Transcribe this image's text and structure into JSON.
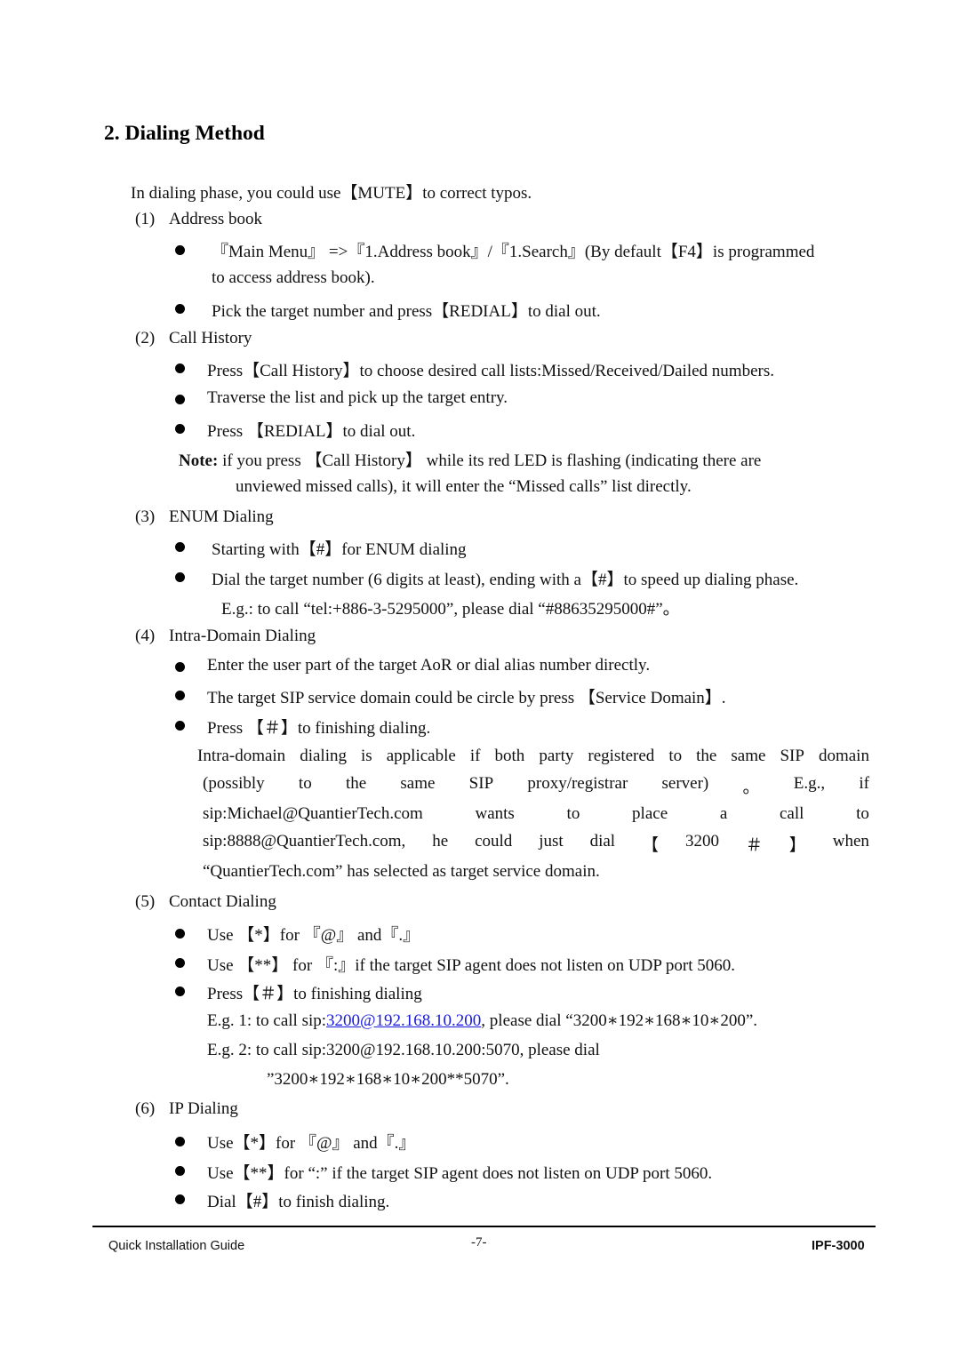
{
  "heading": "2.  Dialing Method",
  "intro": "In dialing phase, you could use【MUTE】to correct typos.",
  "sections": [
    {
      "num": "(1)",
      "title": "Address book",
      "bullets": [
        "『Main Menu』 =>『1.Address book』/『1.Search』(By default【F4】is programmed",
        "Pick the target number and press【REDIAL】to dial out."
      ],
      "continuation": "to access address book)."
    },
    {
      "num": "(2)",
      "title": "Call History",
      "bullets": [
        "Press【Call History】to choose desired call lists:Missed/Received/Dailed numbers.",
        "Traverse the list and pick up the target entry.",
        "Press 【REDIAL】to dial out."
      ],
      "note_label": "Note:",
      "note_line1": " if you press 【Call History】 while its red LED is flashing (indicating there are",
      "note_line2": "unviewed missed calls), it will enter the “Missed calls” list directly."
    },
    {
      "num": "(3)",
      "title": "ENUM Dialing",
      "bullets": [
        "Starting with【#】for ENUM dialing",
        "Dial the target number (6 digits at least), ending with a【#】to speed up dialing phase."
      ],
      "example": "E.g.: to call “tel:+886-3-5295000”, please dial “#88635295000#”。"
    },
    {
      "num": "(4)",
      "title": "Intra-Domain Dialing",
      "bullets": [
        "Enter the user part of the target AoR or dial alias number directly.",
        "The target SIP service domain could be circle by press 【Service Domain】.",
        "Press 【＃】to finishing dialing."
      ],
      "paragraph_lines": [
        [
          "Intra-domain",
          "dialing",
          "is",
          "applicable",
          "if",
          "both",
          "party",
          "registered",
          "to",
          "the",
          "same",
          "SIP",
          "domain"
        ],
        [
          "(possibly",
          "to",
          "the",
          "same",
          "SIP",
          "proxy/registrar",
          "server)",
          "。",
          "E.g.,",
          "if"
        ],
        [
          "sip:Michael@QuantierTech.com",
          "wants",
          "to",
          "place",
          "a",
          "call",
          "to"
        ],
        [
          "sip:8888@QuantierTech.com,",
          "he",
          "could",
          "just",
          "dial",
          "【",
          "3200",
          "＃",
          "】",
          "when"
        ]
      ],
      "paragraph_last": "“QuantierTech.com” has selected as target service domain."
    },
    {
      "num": "(5)",
      "title": "Contact Dialing",
      "bullets": [
        "Use 【*】for 『@』 and『.』",
        "Use 【**】 for 『:』if the target SIP agent does not listen on UDP port 5060.",
        "Press【＃】to finishing dialing"
      ],
      "eg1_prefix": "E.g. 1: to call sip:",
      "eg1_link": "3200@192.168.10.200",
      "eg1_suffix": ", please dial “3200∗192∗168∗10∗200”.",
      "eg2_line1": "E.g. 2: to call sip:3200@192.168.10.200:5070, please dial",
      "eg2_line2": "”3200∗192∗168∗10∗200**5070”."
    },
    {
      "num": "(6)",
      "title": "IP Dialing",
      "bullets": [
        "Use【*】for 『@』 and『.』",
        "Use【**】for “:” if the target SIP agent does not listen on UDP port 5060.",
        "Dial【#】to finish dialing."
      ]
    }
  ],
  "footer": {
    "left": "Quick Installation Guide",
    "center": "-7-",
    "right": "IPF-3000"
  },
  "colors": {
    "link": "#1a1adf",
    "text": "#111111"
  }
}
